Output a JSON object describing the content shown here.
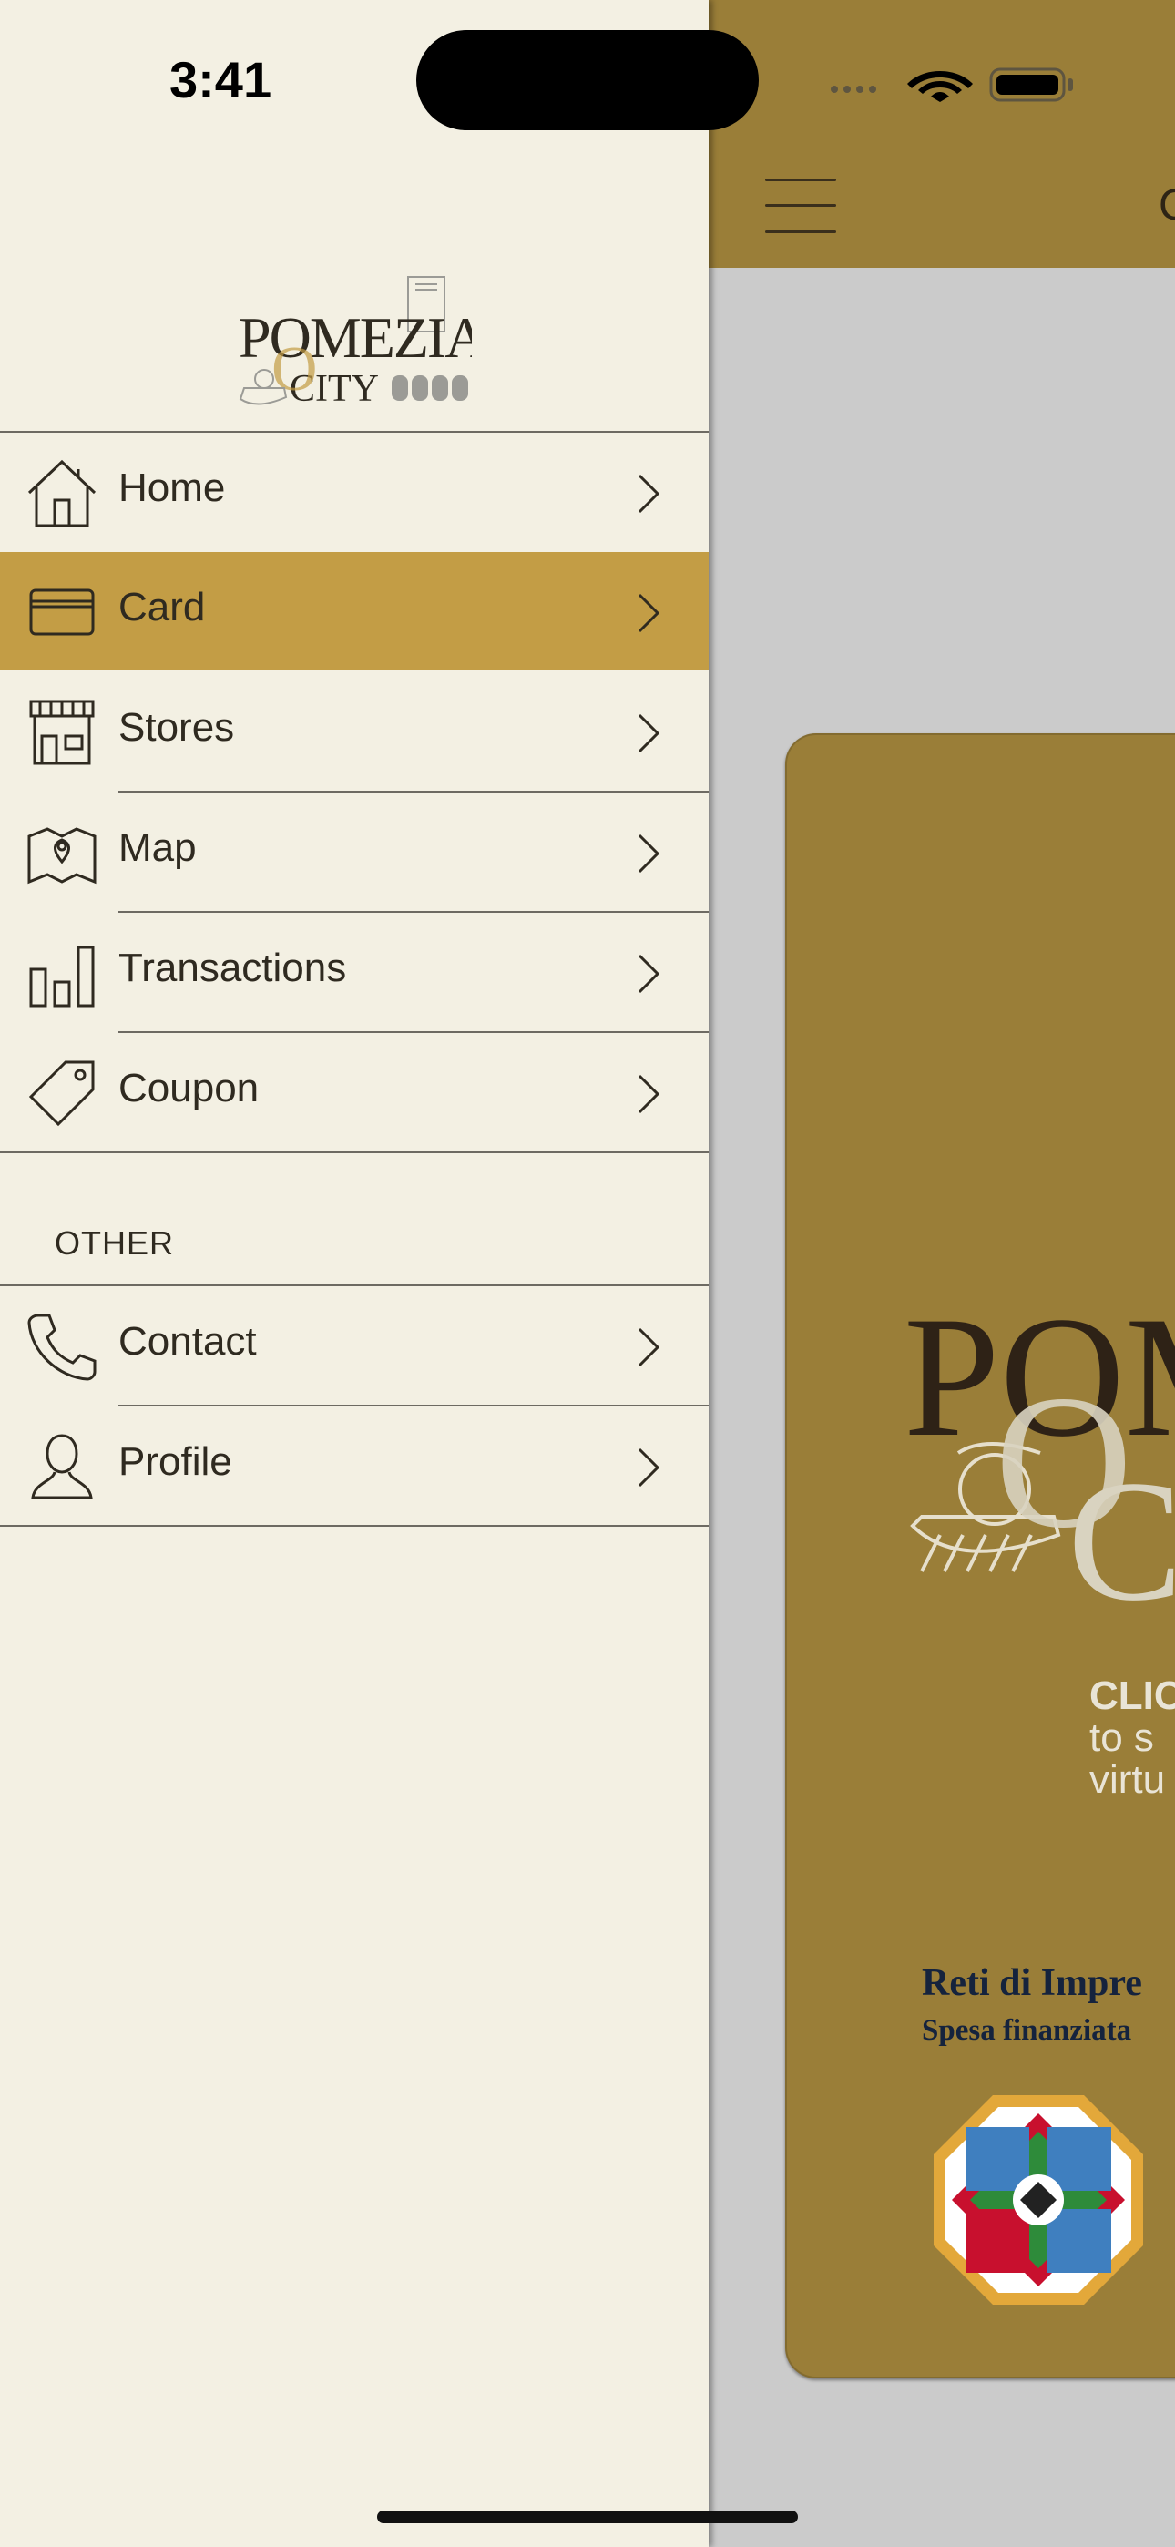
{
  "status_bar": {
    "time": "3:41"
  },
  "background_screen": {
    "header_title_partial": "C",
    "card": {
      "brand_top": "POM",
      "brand_bottom": "C",
      "cta_bold": "CLIC",
      "cta_line2": "to s",
      "cta_line3": "virtu",
      "funding_line1": "Reti di Impre",
      "funding_line2": "Spesa finanziata"
    }
  },
  "drawer": {
    "logo": {
      "text_top": "POMEZIA",
      "text_bottom": "CITY"
    },
    "menu": [
      {
        "label": "Home",
        "icon": "home-icon"
      },
      {
        "label": "Card",
        "icon": "card-icon",
        "active": true
      },
      {
        "label": "Stores",
        "icon": "store-icon"
      },
      {
        "label": "Map",
        "icon": "map-icon"
      },
      {
        "label": "Transactions",
        "icon": "bar-chart-icon"
      },
      {
        "label": "Coupon",
        "icon": "tag-icon"
      }
    ],
    "other_section_title": "OTHER",
    "other": [
      {
        "label": "Contact",
        "icon": "phone-icon"
      },
      {
        "label": "Profile",
        "icon": "user-icon"
      }
    ]
  },
  "colors": {
    "drawer_bg": "#f3f0e3",
    "active_row": "#c39d45",
    "header_gold": "#9a7e38",
    "text_dark": "#2f2a20"
  }
}
